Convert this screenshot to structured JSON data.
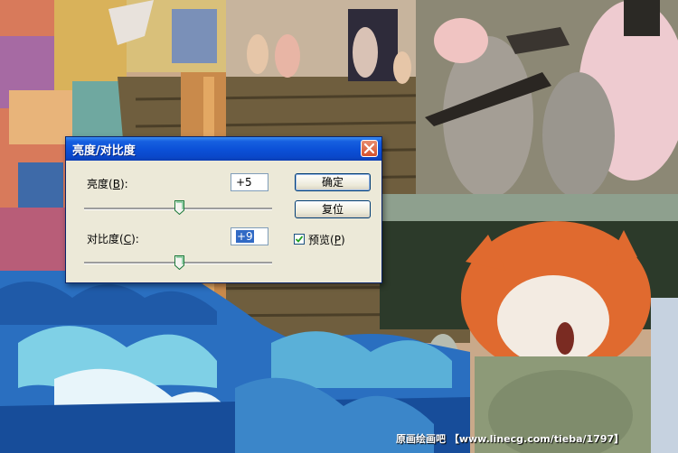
{
  "dialog": {
    "title": "亮度/对比度",
    "brightness": {
      "label": "亮度",
      "mnemonic": "B",
      "value": "+5",
      "level": 0.505
    },
    "contrast": {
      "label": "对比度",
      "mnemonic": "C",
      "value": "+9",
      "level": 0.509
    },
    "ok_label": "确定",
    "reset_label": "复位",
    "preview": {
      "label": "预览",
      "mnemonic": "P",
      "checked": true
    }
  },
  "watermark": "原画绘画吧  【www.linecg.com/tieba/1797】",
  "colors": {
    "titlebar": "#0a47c9",
    "dialog_bg": "#ece9d8",
    "selection": "#316ac5",
    "close": "#d4512d"
  },
  "icons": [
    "close-icon",
    "slider-thumb",
    "check-icon"
  ]
}
